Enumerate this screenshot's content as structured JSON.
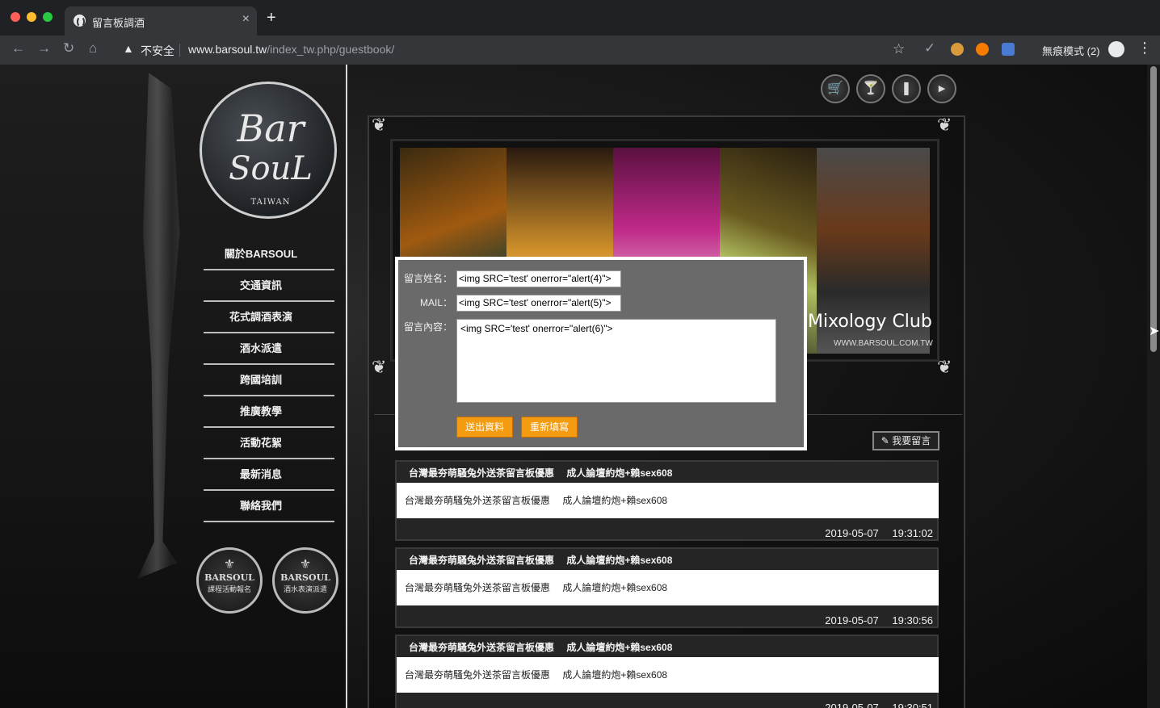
{
  "browser": {
    "tab_title": "留言板調酒",
    "tab_close": "×",
    "new_tab": "+",
    "insecure_label": "不安全",
    "url_domain": "www.barsoul.tw",
    "url_path": "/index_tw.php/guestbook/",
    "incognito_label": "無痕模式 (2)"
  },
  "logo": {
    "line1": "Bar",
    "line2": "SouL",
    "sub": "TAIWAN"
  },
  "nav": {
    "items": [
      {
        "label": "關於BARSOUL"
      },
      {
        "label": "交通資訊"
      },
      {
        "label": "花式調酒表演"
      },
      {
        "label": "酒水派遣"
      },
      {
        "label": "跨國培訓"
      },
      {
        "label": "推廣教學"
      },
      {
        "label": "活動花絮"
      },
      {
        "label": "最新消息"
      },
      {
        "label": "聯絡我們"
      }
    ]
  },
  "badges": [
    {
      "name": "BARSOUL",
      "sub": "課程活動報名"
    },
    {
      "name": "BARSOUL",
      "sub": "酒水表演派遣"
    }
  ],
  "banner": {
    "club_name": "Mixology Club",
    "club_url": "WWW.BARSOUL.COM.TW"
  },
  "form": {
    "name_label": "留言姓名：",
    "mail_label": "MAIL：",
    "content_label": "留言內容：",
    "name_value": "<img SRC='test' onerror=\"alert(4)\">",
    "mail_value": "<img SRC='test' onerror=\"alert(5)\">",
    "content_value": "<img SRC='test' onerror=\"alert(6)\">",
    "submit_label": "送出資料",
    "reset_label": "重新填寫"
  },
  "leave_message_label": "我要留言",
  "entries": [
    {
      "title": "台灣最夯萌騷兔外送茶留言板優惠　 成人論壇約炮+賴sex608",
      "body": "台灣最夯萌騷兔外送茶留言板優惠　 成人論壇約炮+賴sex608",
      "date": "2019-05-07　 19:31:02"
    },
    {
      "title": "台灣最夯萌騷兔外送茶留言板優惠　 成人論壇約炮+賴sex608",
      "body": "台灣最夯萌騷兔外送茶留言板優惠　 成人論壇約炮+賴sex608",
      "date": "2019-05-07　 19:30:56"
    },
    {
      "title": "台灣最夯萌騷兔外送茶留言板優惠　 成人論壇約炮+賴sex608",
      "body": "台灣最夯萌騷兔外送茶留言板優惠　 成人論壇約炮+賴sex608",
      "date": "2019-05-07　 19:30:51"
    }
  ],
  "colors": {
    "accent_button": "#f39c12",
    "page_bg": "#111111"
  }
}
